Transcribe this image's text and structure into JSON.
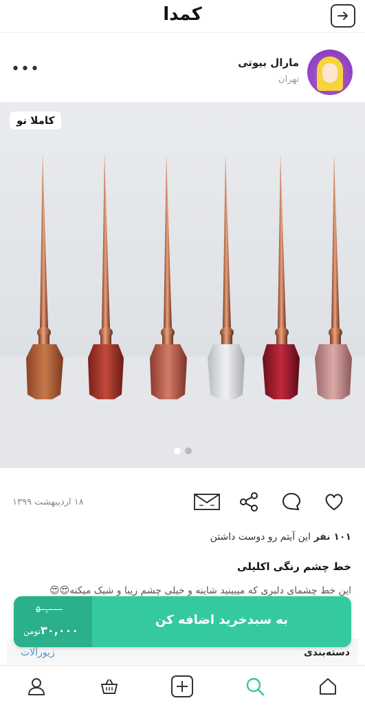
{
  "header": {
    "logo": "کمدا"
  },
  "seller": {
    "name": "مارال بیوتی",
    "city": "تهران",
    "more": "•••"
  },
  "photo": {
    "badge": "کاملا نو",
    "slides": 2,
    "active_slide": 1
  },
  "post": {
    "date": "۱۸ اردیبهشت ۱۳۹۹",
    "likes_count": "۱۰۱ نفر",
    "likes_text": " این آیتم رو دوست داشتن",
    "title": "خط چشم رنگی اکلیلی",
    "description": "این خط چشمای دلبری که میبینید شاینه و خیلی چشم زیبا و شیک میکنه😍😍"
  },
  "category": {
    "label": "دسته‌بندی",
    "value": "زیورآلات"
  },
  "cart": {
    "label": "به سبدخرید اضافه کن",
    "old_price": "۵۰,۰۰۰",
    "new_price": "۳۰,۰۰۰",
    "currency": "تومن"
  },
  "colors": {
    "accent": "#35c9a0",
    "accent_dark": "#2bb08c",
    "link": "#4a90c8"
  },
  "bottom_nav": [
    "home-icon",
    "search-icon",
    "add-icon",
    "basket-icon",
    "profile-icon"
  ]
}
